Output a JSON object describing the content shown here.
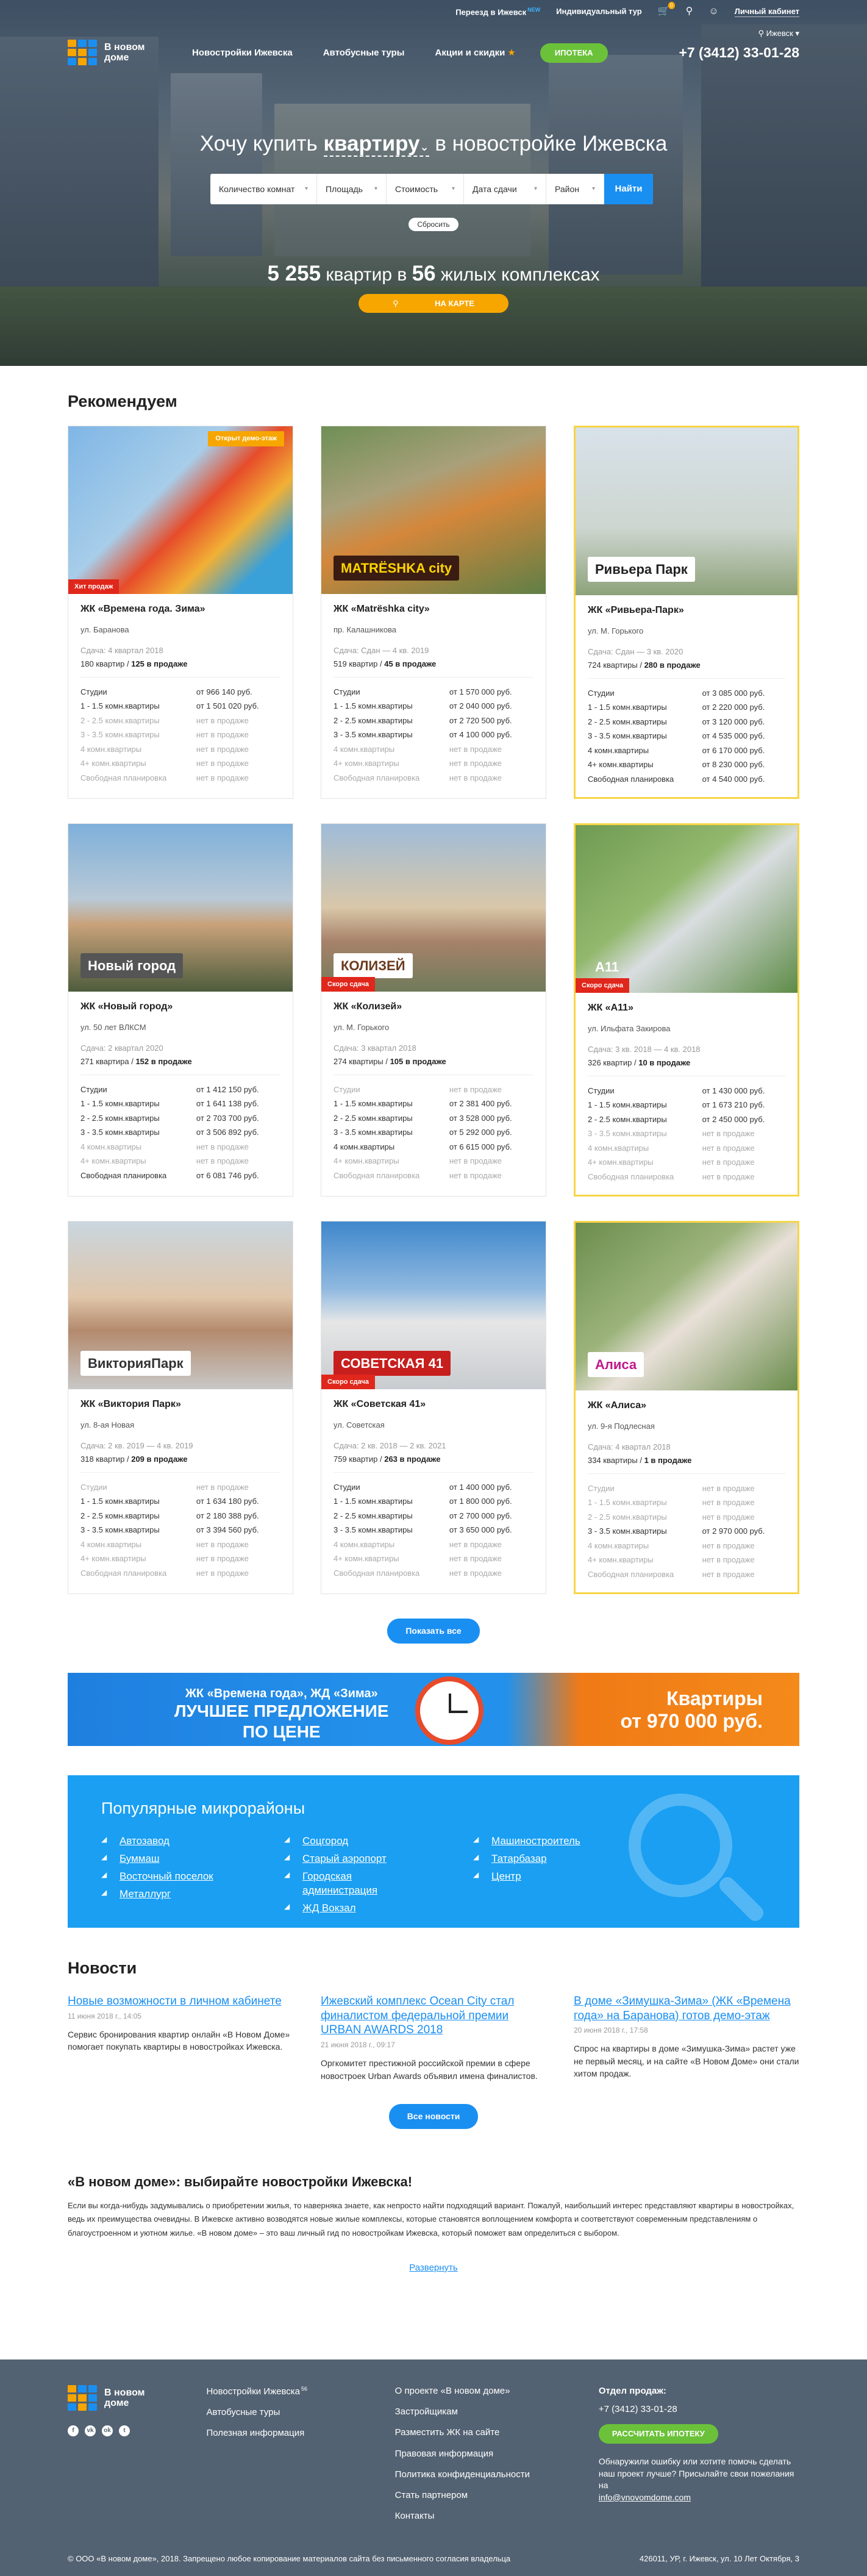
{
  "topbar": {
    "move": "Переезд в Ижевск",
    "move_badge": "NEW",
    "tour": "Индивидуальный тур",
    "cart_count": "0",
    "cabinet": "Личный кабинет",
    "city": "Ижевск"
  },
  "logo": {
    "line1": "В новом",
    "line2": "доме"
  },
  "nav": {
    "items": [
      "Новостройки Ижевска",
      "Автобусные туры",
      "Акции и скидки"
    ],
    "ipoteka": "ИПОТЕКА",
    "phone": "+7 (3412) 33-01-28"
  },
  "hero": {
    "title_pre": "Хочу купить",
    "title_key": "квартиру",
    "title_post": "в новостройке Ижевска",
    "filters": [
      "Количество комнат",
      "Площадь",
      "Стоимость",
      "Дата сдачи",
      "Район"
    ],
    "find": "Найти",
    "reset": "Сбросить",
    "count_num": "5 255",
    "count_mid": "квартир в",
    "count_num2": "56",
    "count_post": "жилых комплексах",
    "map": "НА КАРТЕ"
  },
  "rec": {
    "title": "Рекомендуем",
    "show_all": "Показать все",
    "cards": [
      {
        "name": "ЖК «Времена года. Зима»",
        "street": "ул. Баранова",
        "due": "Сдача: 4 квартал 2018",
        "total": "180 квартир",
        "sale": "125 в продаже",
        "tag": "Хит продаж",
        "badge": "Открыт демо-этаж",
        "brand": "",
        "hl": false,
        "rows": [
          [
            "Студии",
            "от 966 140 руб."
          ],
          [
            "1 - 1.5 комн.квартиры",
            "от 1 501 020 руб."
          ],
          [
            "2 - 2.5 комн.квартиры",
            "нет в продаже"
          ],
          [
            "3 - 3.5 комн.квартиры",
            "нет в продаже"
          ],
          [
            "4 комн.квартиры",
            "нет в продаже"
          ],
          [
            "4+ комн.квартиры",
            "нет в продаже"
          ],
          [
            "Свободная планировка",
            "нет в продаже"
          ]
        ]
      },
      {
        "name": "ЖК «Matrёshka city»",
        "street": "пр. Калашникова",
        "due": "Сдача: Сдан — 4 кв. 2019",
        "total": "519 квартир",
        "sale": "45 в продаже",
        "tag": "",
        "badge": "",
        "brand": "MATRЁSHKA city",
        "hl": false,
        "rows": [
          [
            "Студии",
            "от 1 570 000 руб."
          ],
          [
            "1 - 1.5 комн.квартиры",
            "от 2 040 000 руб."
          ],
          [
            "2 - 2.5 комн.квартиры",
            "от 2 720 500 руб."
          ],
          [
            "3 - 3.5 комн.квартиры",
            "от 4 100 000 руб."
          ],
          [
            "4 комн.квартиры",
            "нет в продаже"
          ],
          [
            "4+ комн.квартиры",
            "нет в продаже"
          ],
          [
            "Свободная планировка",
            "нет в продаже"
          ]
        ]
      },
      {
        "name": "ЖК «Ривьера-Парк»",
        "street": "ул. М. Горького",
        "due": "Сдача: Сдан — 3 кв. 2020",
        "total": "724 квартиры",
        "sale": "280 в продаже",
        "tag": "",
        "badge": "",
        "brand": "Ривьера Парк",
        "hl": true,
        "rows": [
          [
            "Студии",
            "от 3 085 000 руб."
          ],
          [
            "1 - 1.5 комн.квартиры",
            "от 2 220 000 руб."
          ],
          [
            "2 - 2.5 комн.квартиры",
            "от 3 120 000 руб."
          ],
          [
            "3 - 3.5 комн.квартиры",
            "от 4 535 000 руб."
          ],
          [
            "4 комн.квартиры",
            "от 6 170 000 руб."
          ],
          [
            "4+ комн.квартиры",
            "от 8 230 000 руб."
          ],
          [
            "Свободная планировка",
            "от 4 540 000 руб."
          ]
        ]
      },
      {
        "name": "ЖК «Новый город»",
        "street": "ул. 50 лет ВЛКСМ",
        "due": "Сдача: 2 квартал 2020",
        "total": "271 квартира",
        "sale": "152 в продаже",
        "tag": "",
        "badge": "",
        "brand": "Новый город",
        "hl": false,
        "rows": [
          [
            "Студии",
            "от 1 412 150 руб."
          ],
          [
            "1 - 1.5 комн.квартиры",
            "от 1 641 138 руб."
          ],
          [
            "2 - 2.5 комн.квартиры",
            "от 2 703 700 руб."
          ],
          [
            "3 - 3.5 комн.квартиры",
            "от 3 506 892 руб."
          ],
          [
            "4 комн.квартиры",
            "нет в продаже"
          ],
          [
            "4+ комн.квартиры",
            "нет в продаже"
          ],
          [
            "Свободная планировка",
            "от 6 081 746 руб."
          ]
        ]
      },
      {
        "name": "ЖК «Колизей»",
        "street": "ул. М. Горького",
        "due": "Сдача: 3 квартал 2018",
        "total": "274 квартиры",
        "sale": "105 в продаже",
        "tag": "Скоро сдача",
        "badge": "",
        "brand": "КОЛИЗЕЙ",
        "hl": false,
        "rows": [
          [
            "Студии",
            "нет в продаже"
          ],
          [
            "1 - 1.5 комн.квартиры",
            "от 2 381 400 руб."
          ],
          [
            "2 - 2.5 комн.квартиры",
            "от 3 528 000 руб."
          ],
          [
            "3 - 3.5 комн.квартиры",
            "от 5 292 000 руб."
          ],
          [
            "4 комн.квартиры",
            "от 6 615 000 руб."
          ],
          [
            "4+ комн.квартиры",
            "нет в продаже"
          ],
          [
            "Свободная планировка",
            "нет в продаже"
          ]
        ]
      },
      {
        "name": "ЖК «А11»",
        "street": "ул. Ильфата Закирова",
        "due": "Сдача: 3 кв. 2018 — 4 кв. 2018",
        "total": "326 квартир",
        "sale": "10 в продаже",
        "tag": "Скоро сдача",
        "badge": "",
        "brand": "A11",
        "hl": true,
        "rows": [
          [
            "Студии",
            "от 1 430 000 руб."
          ],
          [
            "1 - 1.5 комн.квартиры",
            "от 1 673 210 руб."
          ],
          [
            "2 - 2.5 комн.квартиры",
            "от 2 450 000 руб."
          ],
          [
            "3 - 3.5 комн.квартиры",
            "нет в продаже"
          ],
          [
            "4 комн.квартиры",
            "нет в продаже"
          ],
          [
            "4+ комн.квартиры",
            "нет в продаже"
          ],
          [
            "Свободная планировка",
            "нет в продаже"
          ]
        ]
      },
      {
        "name": "ЖК «Виктория Парк»",
        "street": "ул. 8-ая Новая",
        "due": "Сдача: 2 кв. 2019 — 4 кв. 2019",
        "total": "318 квартир",
        "sale": "209 в продаже",
        "tag": "",
        "badge": "",
        "brand": "ВикторияПарк",
        "hl": false,
        "rows": [
          [
            "Студии",
            "нет в продаже"
          ],
          [
            "1 - 1.5 комн.квартиры",
            "от 1 634 180 руб."
          ],
          [
            "2 - 2.5 комн.квартиры",
            "от 2 180 388 руб."
          ],
          [
            "3 - 3.5 комн.квартиры",
            "от 3 394 560 руб."
          ],
          [
            "4 комн.квартиры",
            "нет в продаже"
          ],
          [
            "4+ комн.квартиры",
            "нет в продаже"
          ],
          [
            "Свободная планировка",
            "нет в продаже"
          ]
        ]
      },
      {
        "name": "ЖК «Советская 41»",
        "street": "ул. Советская",
        "due": "Сдача: 2 кв. 2018 — 2 кв. 2021",
        "total": "759 квартир",
        "sale": "263 в продаже",
        "tag": "Скоро сдача",
        "badge": "",
        "brand": "СОВЕТСКАЯ 41",
        "hl": false,
        "rows": [
          [
            "Студии",
            "от 1 400 000 руб."
          ],
          [
            "1 - 1.5 комн.квартиры",
            "от 1 800 000 руб."
          ],
          [
            "2 - 2.5 комн.квартиры",
            "от 2 700 000 руб."
          ],
          [
            "3 - 3.5 комн.квартиры",
            "от 3 650 000 руб."
          ],
          [
            "4 комн.квартиры",
            "нет в продаже"
          ],
          [
            "4+ комн.квартиры",
            "нет в продаже"
          ],
          [
            "Свободная планировка",
            "нет в продаже"
          ]
        ]
      },
      {
        "name": "ЖК «Алиса»",
        "street": "ул. 9-я Подлесная",
        "due": "Сдача: 4 квартал 2018",
        "total": "334 квартиры",
        "sale": "1 в продаже",
        "tag": "",
        "badge": "",
        "brand": "Алиса",
        "hl": true,
        "rows": [
          [
            "Студии",
            "нет в продаже"
          ],
          [
            "1 - 1.5 комн.квартиры",
            "нет в продаже"
          ],
          [
            "2 - 2.5 комн.квартиры",
            "нет в продаже"
          ],
          [
            "3 - 3.5 комн.квартиры",
            "от 2 970 000 руб."
          ],
          [
            "4 комн.квартиры",
            "нет в продаже"
          ],
          [
            "4+ комн.квартиры",
            "нет в продаже"
          ],
          [
            "Свободная планировка",
            "нет в продаже"
          ]
        ]
      }
    ]
  },
  "promo": {
    "line1": "ЖК «Времена года», ЖД «Зима»",
    "line2": "ЛУЧШЕЕ ПРЕДЛОЖЕНИЕ",
    "line3": "ПО ЦЕНЕ",
    "right1": "Квартиры",
    "right2": "от 970 000 руб."
  },
  "micro": {
    "title": "Популярные микрорайоны",
    "col1": [
      "Автозавод",
      "Буммаш",
      "Восточный поселок",
      "Металлург"
    ],
    "col2": [
      "Соцгород",
      "Старый аэропорт",
      "Городская администрация",
      "ЖД Вокзал"
    ],
    "col3": [
      "Машиностроитель",
      "Татарбазар",
      "Центр"
    ]
  },
  "news": {
    "title": "Новости",
    "items": [
      {
        "t": "Новые возможности в личном кабинете",
        "d": "11 июня 2018 г., 14:05",
        "x": "Сервис бронирования квартир онлайн «В Новом Доме» помогает покупать квартиры в новостройках Ижевска."
      },
      {
        "t": "Ижевский комплекс Ocean City стал финалистом федеральной премии URBAN AWARDS 2018",
        "d": "21 июня 2018 г., 09:17",
        "x": "Оргкомитет престижной российской премии в сфере новостроек Urban Awards объявил имена финалистов."
      },
      {
        "t": "В доме «Зимушка-Зима» (ЖК «Времена года» на Баранова) готов демо-этаж",
        "d": "20 июня 2018 г., 17:58",
        "x": "Спрос на квартиры в доме «Зимушка-Зима» растет уже не первый месяц, и на сайте «В Новом Доме» они стали хитом продаж."
      }
    ],
    "all": "Все новости"
  },
  "about": {
    "title": "«В новом доме»: выбирайте новостройки Ижевска!",
    "text": "Если вы когда-нибудь задумывались о приобретении жилья, то наверняка знаете, как непросто найти подходящий вариант. Пожалуй, наибольший интерес представляют квартиры в новостройках, ведь их преимущества очевидны. В Ижевске активно возводятся новые жилые комплексы, которые становятся воплощением комфорта и соответствуют современным представлениям о благоустроенном и уютном жилье. «В новом доме» – это ваш личный гид по новостройкам Ижевска, который поможет вам определиться с выбором.",
    "expand": "Развернуть"
  },
  "footer": {
    "menu1": [
      "Новостройки Ижевска",
      "Автобусные туры",
      "Полезная информация"
    ],
    "menu1_sup": "56",
    "menu2": [
      "О проекте «В новом доме»",
      "Застройщикам",
      "Разместить ЖК на сайте",
      "Правовая информация",
      "Политика конфиденциальности",
      "Стать партнером",
      "Контакты"
    ],
    "sales_h": "Отдел продаж:",
    "sales_phone": "+7 (3412) 33-01-28",
    "calc": "РАССЧИТАТЬ ИПОТЕКУ",
    "err": "Обнаружили ошибку или хотите помочь сделать наш проект лучше? Присылайте свои пожелания на",
    "mail": "info@vnovomdome.com",
    "copy": "© ООО «В новом доме», 2018. Запрещено любое копирование материалов сайта без письменного согласия владельца",
    "addr": "426011, УР, г. Ижевск, ул. 10 Лет Октября, 3"
  },
  "colors": {
    "accent": "#1a8ff2",
    "orange": "#f7a600",
    "green": "#6bc23a",
    "red": "#e0271b",
    "footer": "#536272"
  }
}
